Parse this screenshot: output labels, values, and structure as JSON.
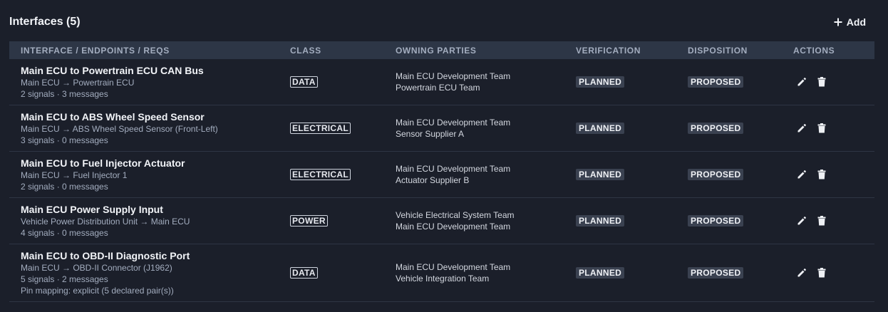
{
  "header": {
    "title": "Interfaces (5)",
    "add_label": "Add"
  },
  "columns": {
    "interface": "INTERFACE / ENDPOINTS / REQS",
    "class": "CLASS",
    "owning_parties": "OWNING PARTIES",
    "verification": "VERIFICATION",
    "disposition": "DISPOSITION",
    "actions": "ACTIONS"
  },
  "rows": [
    {
      "name": "Main ECU to Powertrain ECU CAN Bus",
      "endpoints": "Main ECU → Powertrain ECU",
      "counts": "2 signals · 3 messages",
      "class": "DATA",
      "owners": [
        "Main ECU Development Team",
        "Powertrain ECU Team"
      ],
      "verification": "PLANNED",
      "disposition": "PROPOSED"
    },
    {
      "name": "Main ECU to ABS Wheel Speed Sensor",
      "endpoints": "Main ECU → ABS Wheel Speed Sensor (Front-Left)",
      "counts": "3 signals · 0 messages",
      "class": "ELECTRICAL",
      "owners": [
        "Main ECU Development Team",
        "Sensor Supplier A"
      ],
      "verification": "PLANNED",
      "disposition": "PROPOSED"
    },
    {
      "name": "Main ECU to Fuel Injector Actuator",
      "endpoints": "Main ECU → Fuel Injector 1",
      "counts": "2 signals · 0 messages",
      "class": "ELECTRICAL",
      "owners": [
        "Main ECU Development Team",
        "Actuator Supplier B"
      ],
      "verification": "PLANNED",
      "disposition": "PROPOSED"
    },
    {
      "name": "Main ECU Power Supply Input",
      "endpoints": "Vehicle Power Distribution Unit → Main ECU",
      "counts": "4 signals · 0 messages",
      "class": "POWER",
      "owners": [
        "Vehicle Electrical System Team",
        "Main ECU Development Team"
      ],
      "verification": "PLANNED",
      "disposition": "PROPOSED"
    },
    {
      "name": "Main ECU to OBD-II Diagnostic Port",
      "endpoints": "Main ECU → OBD-II Connector (J1962)",
      "counts": "5 signals · 2 messages",
      "pin_mapping": "Pin mapping: explicit (5 declared pair(s))",
      "class": "DATA",
      "owners": [
        "Main ECU Development Team",
        "Vehicle Integration Team"
      ],
      "verification": "PLANNED",
      "disposition": "PROPOSED"
    }
  ],
  "icons": {
    "add": "plus-icon",
    "edit": "pencil-icon",
    "delete": "trash-icon"
  }
}
